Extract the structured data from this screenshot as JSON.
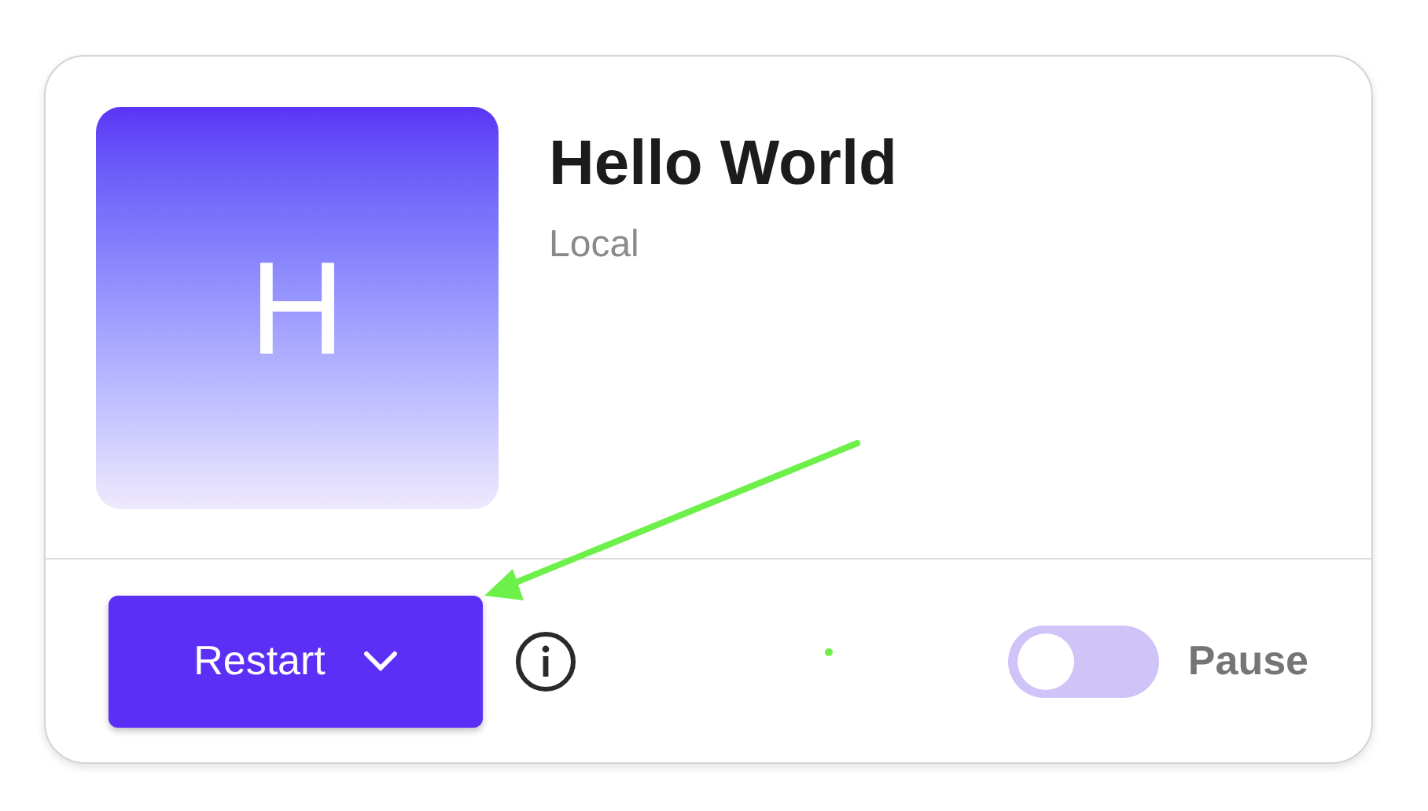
{
  "app": {
    "initial": "H",
    "title": "Hello World",
    "subtitle": "Local"
  },
  "actions": {
    "restart_button": "Restart",
    "toggle": {
      "label": "Pause",
      "on": false
    }
  }
}
